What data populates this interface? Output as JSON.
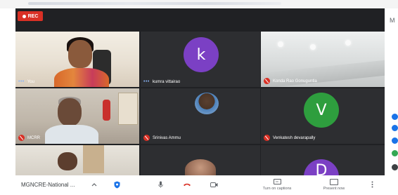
{
  "recording": {
    "label": "REC",
    "color": "#d93025"
  },
  "participants": [
    {
      "id": "you",
      "name": "You",
      "indicator": "speaking-dots"
    },
    {
      "id": "kumra",
      "name": "kumra vittairao",
      "avatar_letter": "k",
      "avatar_color": "#7b40c4",
      "indicator": "speaking-dots"
    },
    {
      "id": "konda",
      "name": "Konda Rao Gonuguntla",
      "indicator": "muted"
    },
    {
      "id": "mcrr",
      "name": "MCRR",
      "indicator": "muted"
    },
    {
      "id": "srinivas",
      "name": "Srinivas Ammu",
      "indicator": "muted"
    },
    {
      "id": "venkatesh",
      "name": "Venkatesh devarapally",
      "avatar_letter": "V",
      "avatar_color": "#2e9e3e",
      "indicator": "muted"
    },
    {
      "id": "bottom-right",
      "avatar_letter": "D",
      "avatar_color": "#7b40c4"
    }
  ],
  "toolbar": {
    "meeting_title": "MGNCRE-National ...",
    "expand_icon": "chevron-up-icon",
    "shield_icon": "shield-icon",
    "mic_icon": "microphone-icon",
    "end_call_icon": "end-call-icon",
    "camera_icon": "camera-icon",
    "captions_label": "Turn on captions",
    "present_label": "Present now",
    "more_icon": "more-vertical-icon"
  },
  "colors": {
    "stage_bg": "#202124",
    "mute_red": "#d93025",
    "accent_blue": "#1a73e8"
  },
  "side_panel": {
    "letter": "M"
  }
}
